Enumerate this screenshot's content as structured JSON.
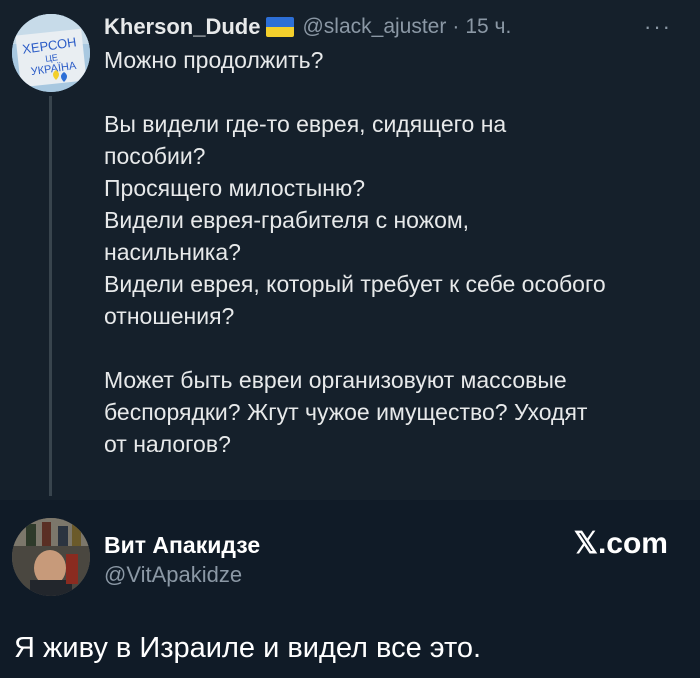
{
  "tweet": {
    "avatar_sign_lines": [
      "ХЕРСОН",
      "ЦЕ",
      "УКРАЇНА"
    ],
    "display_name": "Kherson_Dude",
    "handle": "@slack_ajuster",
    "separator": "·",
    "time": "15 ч.",
    "more_icon": "···",
    "paragraphs": [
      "Можно продолжить?",
      "Вы видели где-то еврея, сидящего на\nпособии?\nПросящего милостыню?\nВидели еврея-грабителя с ножом,\nнасильника?\nВидели еврея, который требует к себе особого\nотношения?",
      "Может быть евреи организовуют массовые\nбеспорядки? Жгут чужое имущество? Уходят\nот налогов?"
    ]
  },
  "reply": {
    "display_name": "Вит Апакидзе",
    "handle": "@VitApakidze",
    "watermark": "𝕏.com",
    "text": "Я живу в Израиле и видел все это."
  },
  "colors": {
    "tweet_background": "#15202b",
    "reply_background": "#101b27",
    "primary_text": "#e7e9ea",
    "secondary_text": "#8b98a5",
    "flag_blue": "#2d6fd6",
    "flag_yellow": "#f3cf2c"
  },
  "icons": {
    "flag": "ukraine-flag-icon",
    "more": "more-options-icon"
  }
}
